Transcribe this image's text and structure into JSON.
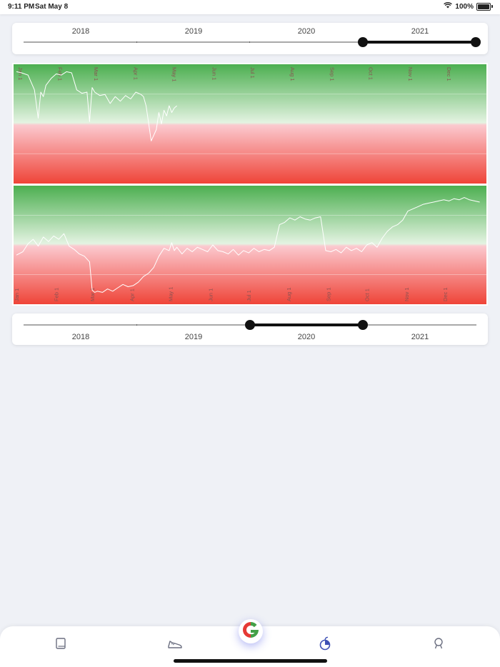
{
  "status": {
    "time": "9:11 PM",
    "date": "Sat May 8",
    "battery": "100%"
  },
  "top_slider": {
    "years": [
      "2018",
      "2019",
      "2020",
      "2021"
    ],
    "selection": {
      "from": "2021",
      "to": "end"
    }
  },
  "bottom_slider": {
    "years": [
      "2018",
      "2019",
      "2020",
      "2021"
    ],
    "selection": {
      "from": "2020",
      "to": "2021"
    }
  },
  "months": [
    "Jan 1",
    "Feb 1",
    "Mar 1",
    "Apr 1",
    "May 1",
    "Jun 1",
    "Jul 1",
    "Aug 1",
    "Sep 1",
    "Oct 1",
    "Nov 1",
    "Dec 1"
  ],
  "colors": {
    "green": "#4caf50",
    "red": "#ef4438",
    "line": "#ffffff"
  },
  "chart_data": [
    {
      "type": "line",
      "title": "",
      "x_unit": "day of year",
      "xlim": [
        1,
        365
      ],
      "ylim": [
        0,
        100
      ],
      "background_bands": [
        "green (top half)",
        "red (bottom half)"
      ],
      "x": [
        1,
        5,
        10,
        15,
        18,
        20,
        22,
        24,
        28,
        32,
        36,
        40,
        44,
        48,
        52,
        56,
        58,
        60,
        62,
        66,
        70,
        74,
        78,
        82,
        86,
        90,
        94,
        98,
        100,
        102,
        106,
        110,
        112,
        114,
        116,
        118,
        120,
        122,
        124,
        126
      ],
      "y": [
        96,
        95,
        93,
        80,
        55,
        78,
        74,
        84,
        90,
        94,
        93,
        96,
        95,
        80,
        77,
        78,
        52,
        82,
        78,
        75,
        76,
        68,
        74,
        70,
        75,
        72,
        78,
        76,
        74,
        66,
        35,
        45,
        60,
        50,
        62,
        57,
        66,
        60,
        64,
        66
      ]
    },
    {
      "type": "line",
      "title": "",
      "x_unit": "day of year",
      "xlim": [
        1,
        365
      ],
      "ylim": [
        0,
        100
      ],
      "background_bands": [
        "green (top half)",
        "red (bottom half)"
      ],
      "x": [
        1,
        6,
        10,
        14,
        18,
        22,
        26,
        30,
        34,
        38,
        42,
        46,
        50,
        54,
        58,
        60,
        62,
        64,
        68,
        72,
        76,
        80,
        84,
        88,
        92,
        96,
        100,
        104,
        108,
        112,
        116,
        120,
        122,
        124,
        126,
        130,
        134,
        138,
        142,
        146,
        150,
        154,
        158,
        162,
        166,
        170,
        174,
        178,
        182,
        186,
        190,
        194,
        198,
        202,
        206,
        210,
        214,
        218,
        222,
        226,
        230,
        234,
        238,
        242,
        246,
        250,
        254,
        258,
        262,
        266,
        270,
        274,
        278,
        282,
        286,
        290,
        294,
        298,
        302,
        306,
        310,
        314,
        318,
        322,
        326,
        330,
        334,
        338,
        342,
        346,
        350,
        354,
        358,
        362
      ],
      "y": [
        41,
        44,
        51,
        55,
        49,
        57,
        53,
        58,
        55,
        60,
        49,
        46,
        42,
        40,
        35,
        10,
        8,
        9,
        8,
        11,
        9,
        12,
        15,
        13,
        14,
        17,
        22,
        25,
        30,
        40,
        47,
        45,
        52,
        45,
        48,
        42,
        47,
        44,
        48,
        46,
        44,
        50,
        45,
        44,
        42,
        46,
        41,
        45,
        43,
        47,
        44,
        46,
        45,
        48,
        68,
        70,
        74,
        72,
        75,
        73,
        72,
        74,
        75,
        45,
        44,
        46,
        43,
        48,
        45,
        47,
        44,
        50,
        52,
        48,
        56,
        62,
        66,
        68,
        72,
        80,
        82,
        84,
        86,
        87,
        88,
        89,
        90,
        89,
        91,
        90,
        92,
        90,
        89,
        88
      ]
    }
  ]
}
